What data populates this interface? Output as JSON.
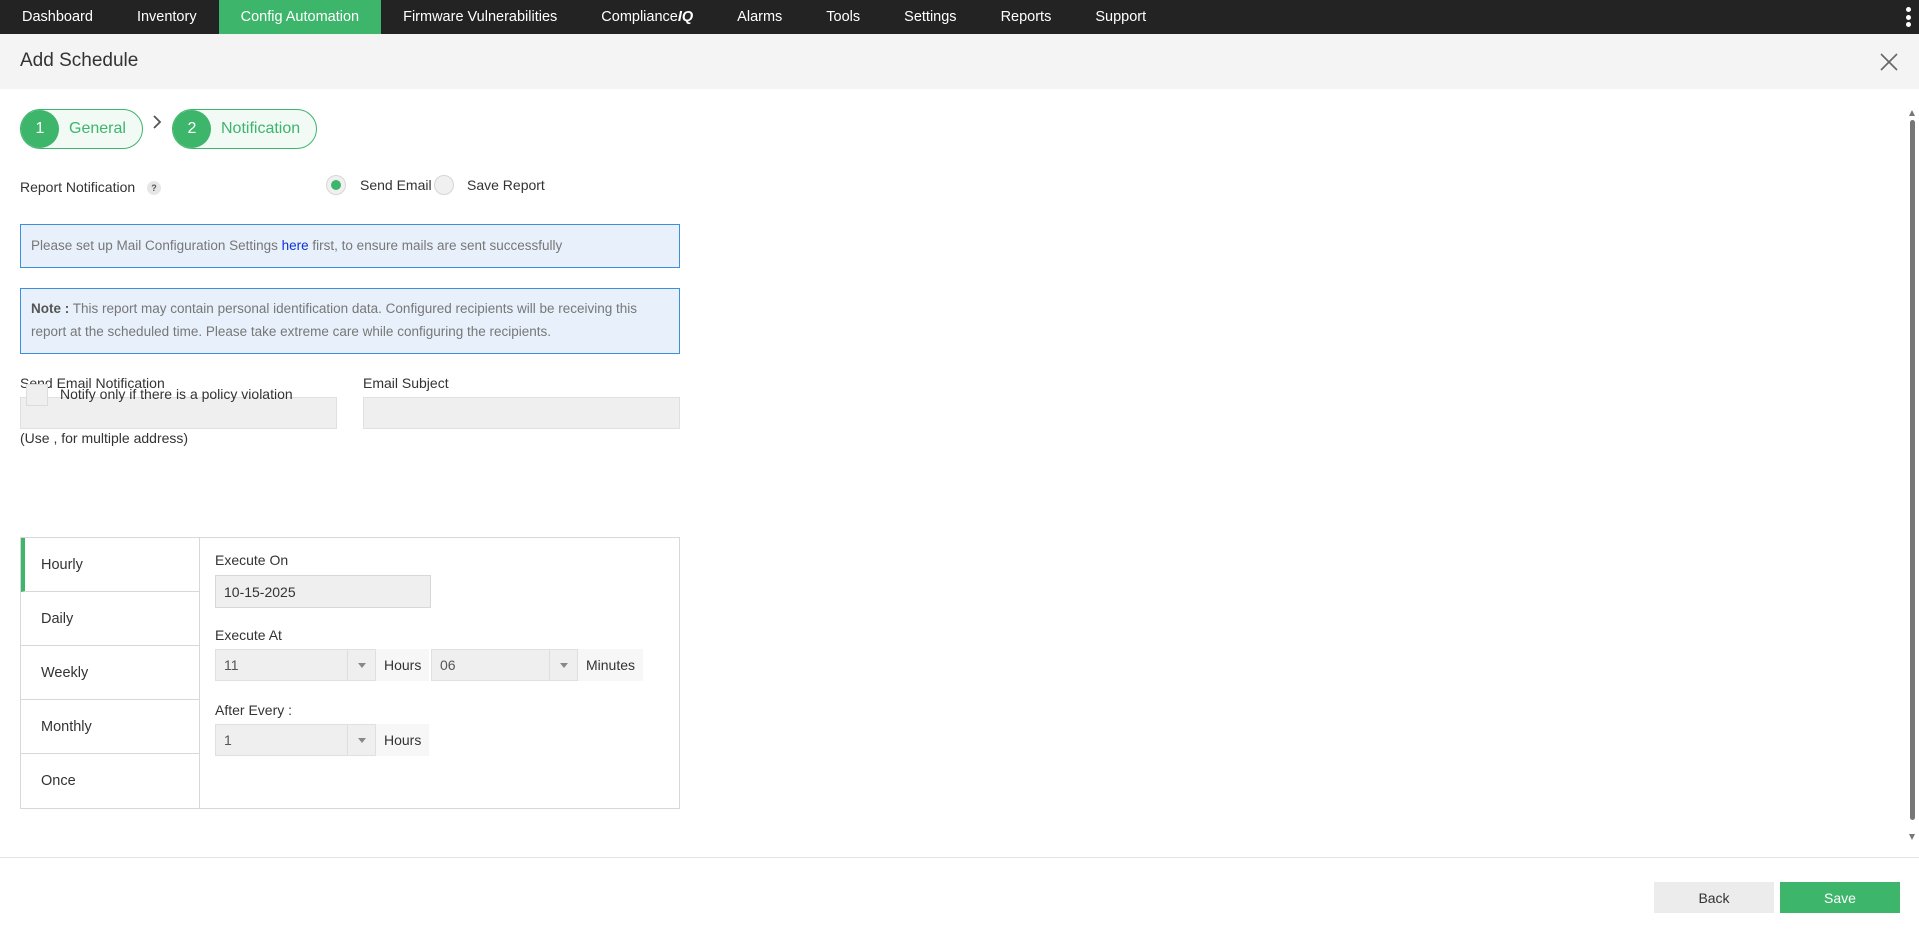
{
  "nav": {
    "items": [
      "Dashboard",
      "Inventory",
      "Config Automation",
      "Firmware Vulnerabilities",
      "Compliance",
      "Alarms",
      "Tools",
      "Settings",
      "Reports",
      "Support"
    ],
    "compliance_suffix": "IQ",
    "active_index": 2
  },
  "header": {
    "title": "Add Schedule"
  },
  "stepper": {
    "steps": [
      {
        "number": "1",
        "label": "General"
      },
      {
        "number": "2",
        "label": "Notification"
      }
    ]
  },
  "notification": {
    "label": "Report Notification",
    "help_glyph": "?",
    "options": [
      {
        "label": "Send Email",
        "checked": true
      },
      {
        "label": "Save Report",
        "checked": false
      }
    ]
  },
  "mail_info": {
    "prefix": "Please set up Mail Configuration Settings ",
    "link": "here",
    "suffix": " first, to ensure mails are sent successfully"
  },
  "note": {
    "label": "Note :",
    "text": " This report may contain personal identification data. Configured recipients will be receiving this report at the scheduled time. Please take extreme care while configuring the recipients."
  },
  "email_form": {
    "recipients_label": "Send Email Notification",
    "recipients_value": "",
    "recipients_hint": "(Use , for multiple address)",
    "subject_label": "Email Subject",
    "subject_value": "",
    "policy_checkbox_label": "Notify only if there is a policy violation",
    "policy_checked": false
  },
  "schedule": {
    "tabs": [
      "Hourly",
      "Daily",
      "Weekly",
      "Monthly",
      "Once"
    ],
    "active_tab": "Hourly",
    "execute_on_label": "Execute On",
    "execute_on_value": "10-15-2025",
    "execute_at_label": "Execute At",
    "hours_value": "11",
    "hours_unit": "Hours",
    "minutes_value": "06",
    "minutes_unit": "Minutes",
    "after_every_label": "After Every :",
    "after_every_value": "1",
    "after_every_unit": "Hours"
  },
  "footer": {
    "back_label": "Back",
    "save_label": "Save"
  },
  "colors": {
    "accent": "#3db56b",
    "nav_bg": "#232323",
    "info_border": "#3a8fe0",
    "info_bg": "#e8f1fb",
    "link": "#0b32d6"
  }
}
